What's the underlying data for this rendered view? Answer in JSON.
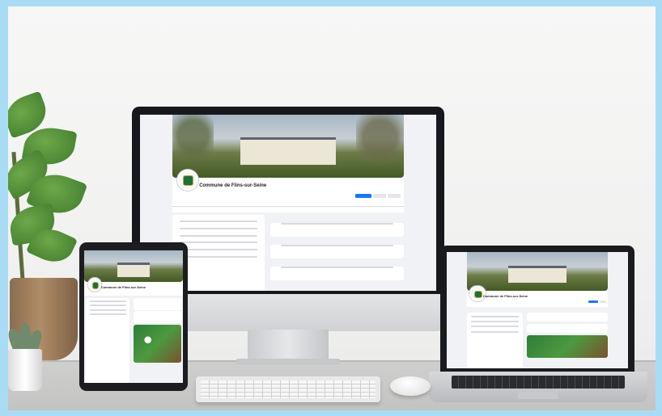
{
  "scene": {
    "description_kind": "product mockup",
    "devices": [
      "desktop-monitor",
      "tablet",
      "laptop"
    ]
  },
  "facebook_page": {
    "page_name": "Commune de Flins-sur-Seine"
  },
  "colors": {
    "background": "#a9dcf4",
    "facebook_blue": "#1877f2",
    "facebook_bg": "#f0f2f5"
  }
}
